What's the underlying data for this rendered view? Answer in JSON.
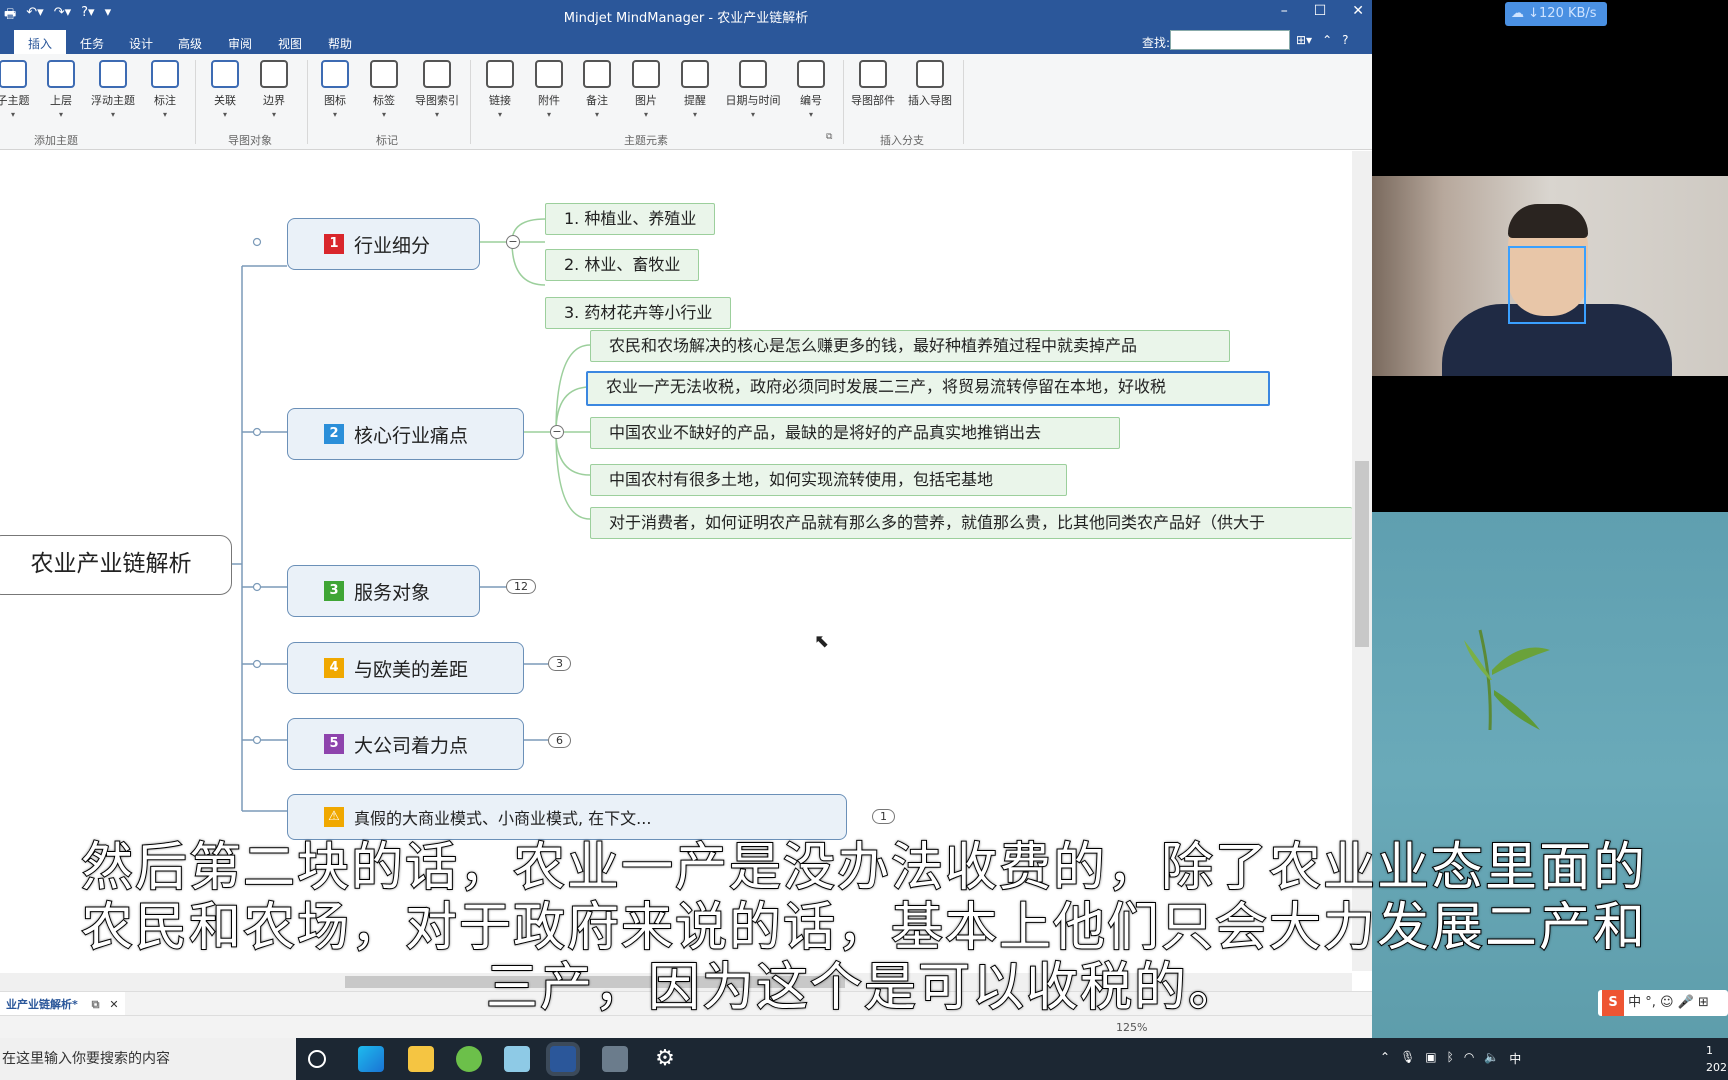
{
  "window": {
    "title": "Mindjet MindManager - 农业产业链解析"
  },
  "ribbon_tabs": [
    "插入",
    "任务",
    "设计",
    "高级",
    "审阅",
    "视图",
    "帮助"
  ],
  "find_label": "查找:",
  "ribbon": {
    "buttons": [
      "子主题",
      "上层",
      "浮动主题",
      "标注",
      "关联",
      "边界",
      "图标",
      "标签",
      "导图索引",
      "链接",
      "附件",
      "备注",
      "图片",
      "提醒",
      "日期与时间",
      "编号",
      "导图部件",
      "插入导图"
    ],
    "groups": [
      "添加主题",
      "导图对象",
      "标记",
      "主题元素",
      "插入分支"
    ]
  },
  "map": {
    "central": "农业产业链解析",
    "topics": [
      {
        "num": "1",
        "label": "行业细分",
        "color": "#d9262b"
      },
      {
        "num": "2",
        "label": "核心行业痛点",
        "color": "#2b8fd9"
      },
      {
        "num": "3",
        "label": "服务对象",
        "color": "#3fa535",
        "count": "12"
      },
      {
        "num": "4",
        "label": "与欧美的差距",
        "color": "#f0a800",
        "count": "3"
      },
      {
        "num": "5",
        "label": "大公司着力点",
        "color": "#8e44ad",
        "count": "6"
      },
      {
        "num": "",
        "label": "真假的大商业模式、小商业模式, 在下文...",
        "count": "1"
      }
    ],
    "sub1": [
      "1. 种植业、养殖业",
      "2. 林业、畜牧业",
      "3. 药材花卉等小行业"
    ],
    "sub2": [
      "农民和农场解决的核心是怎么赚更多的钱，最好种植养殖过程中就卖掉产品",
      "农业一产无法收税，政府必须同时发展二三产，将贸易流转停留在本地，好收税",
      "中国农业不缺好的产品，最缺的是将好的产品真实地推销出去",
      "中国农村有很多土地，如何实现流转使用，包括宅基地",
      "对于消费者，如何证明农产品就有那么多的营养，就值那么贵，比其他同类农产品好（供大于"
    ]
  },
  "doc_tab": "业产业链解析*",
  "zoom": "125%",
  "net_speed": "120 KB/s",
  "subtitle": {
    "line1": "然后第二块的话，农业一产是没办法收费的，除了农业业态里面的",
    "line2": "农民和农场，对于政府来说的话，基本上他们只会大力发展二产和",
    "line3": "三产，因为这个是可以收税的。"
  },
  "taskbar": {
    "search_placeholder": "在这里输入你要搜索的内容",
    "ime": "中",
    "clock_time": "1",
    "clock_date": "202"
  },
  "ime_bar": "中 °,"
}
